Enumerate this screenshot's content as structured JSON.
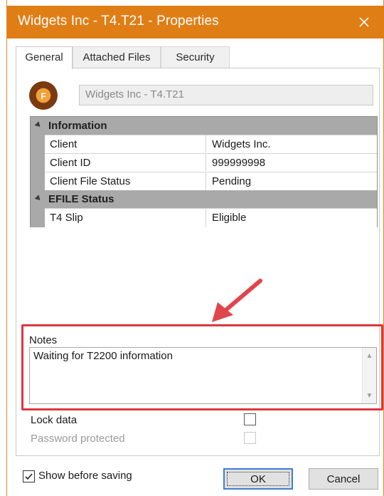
{
  "window": {
    "title": "Widgets Inc - T4.T21 - Properties",
    "close_icon": "close-icon"
  },
  "tabs": [
    {
      "label": "General",
      "active": true
    },
    {
      "label": "Attached Files",
      "active": false
    },
    {
      "label": "Security",
      "active": false
    }
  ],
  "header": {
    "avatar_letter": "F",
    "name_value": "Widgets Inc - T4.T21"
  },
  "properties": {
    "sections": [
      {
        "title": "Information",
        "rows": [
          {
            "label": "Client",
            "value": "Widgets Inc."
          },
          {
            "label": "Client ID",
            "value": "999999998"
          },
          {
            "label": "Client File Status",
            "value": "Pending"
          }
        ]
      },
      {
        "title": "EFILE Status",
        "rows": [
          {
            "label": "T4 Slip",
            "value": "Eligible"
          }
        ]
      }
    ]
  },
  "notes": {
    "label": "Notes",
    "value": "Waiting for T2200 information"
  },
  "options": {
    "lock_data": {
      "label": "Lock data",
      "checked": false,
      "enabled": true
    },
    "password_protected": {
      "label": "Password protected",
      "checked": false,
      "enabled": false
    }
  },
  "footer": {
    "show_before_saving": {
      "label": "Show before saving",
      "checked": true
    },
    "ok_label": "OK",
    "cancel_label": "Cancel"
  },
  "colors": {
    "titlebar": "#e07e16",
    "highlight": "#d9383f",
    "arrow": "#e0454b",
    "section": "#a9a9a9"
  }
}
